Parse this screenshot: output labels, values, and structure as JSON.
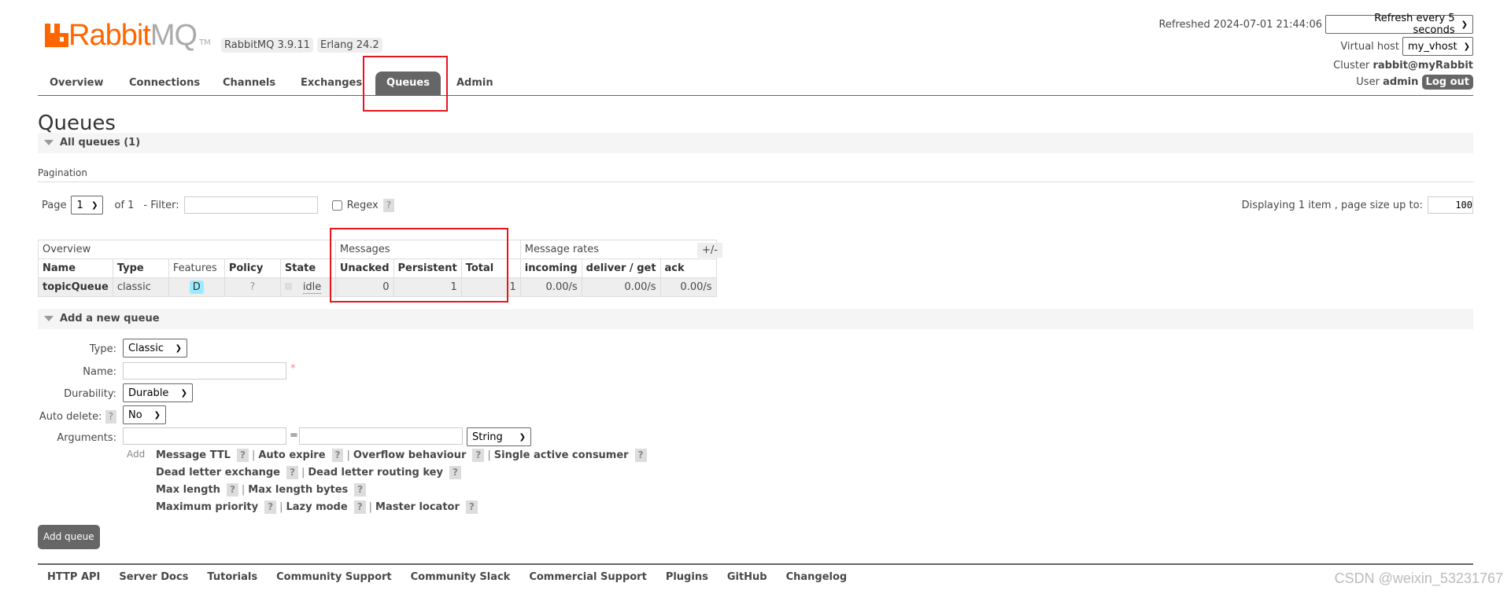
{
  "header": {
    "logo_text": "RabbitMQ",
    "logo_tm": "TM",
    "version": "RabbitMQ 3.9.11",
    "erlang": "Erlang 24.2",
    "refreshed_label": "Refreshed 2024-07-01 21:44:06",
    "refresh_select": "Refresh every 5 seconds",
    "vhost_label": "Virtual host",
    "vhost_select": "my_vhost",
    "cluster_label": "Cluster",
    "cluster_name": "rabbit@myRabbit",
    "user_label": "User",
    "user_name": "admin",
    "logout": "Log out"
  },
  "nav": {
    "tabs": [
      {
        "label": "Overview"
      },
      {
        "label": "Connections"
      },
      {
        "label": "Channels"
      },
      {
        "label": "Exchanges"
      },
      {
        "label": "Queues",
        "active": true
      },
      {
        "label": "Admin"
      }
    ]
  },
  "page": {
    "title": "Queues",
    "all_queues": "All queues (1)",
    "pagination": "Pagination",
    "page_label": "Page",
    "page_value": "1",
    "of_label": "of 1",
    "filter_label": "- Filter:",
    "filter_value": "",
    "regex_label": "Regex",
    "help": "?",
    "displaying": "Displaying 1 item , page size up to:",
    "page_size": "100"
  },
  "table": {
    "groups": [
      "Overview",
      "Messages",
      "Message rates"
    ],
    "toggle": "+/-",
    "columns": [
      "Name",
      "Type",
      "Features",
      "Policy",
      "State",
      "Unacked",
      "Persistent",
      "Total",
      "incoming",
      "deliver / get",
      "ack"
    ],
    "rows": [
      {
        "name": "topicQueue",
        "type": "classic",
        "features": "D",
        "policy": "?",
        "state": "idle",
        "unacked": "0",
        "persistent": "1",
        "total": "1",
        "incoming": "0.00/s",
        "deliver_get": "0.00/s",
        "ack": "0.00/s"
      }
    ]
  },
  "add_queue": {
    "section": "Add a new queue",
    "type_label": "Type:",
    "type_value": "Classic",
    "name_label": "Name:",
    "name_value": "",
    "required": "*",
    "durability_label": "Durability:",
    "durability_value": "Durable",
    "autodelete_label": "Auto delete:",
    "autodelete_value": "No",
    "arguments_label": "Arguments:",
    "eq": "=",
    "arg_type": "String",
    "add_label": "Add",
    "arg_lines": [
      [
        "Message TTL",
        "Auto expire",
        "Overflow behaviour",
        "Single active consumer"
      ],
      [
        "Dead letter exchange",
        "Dead letter routing key"
      ],
      [
        "Max length",
        "Max length bytes"
      ],
      [
        "Maximum priority",
        "Lazy mode",
        "Master locator"
      ]
    ],
    "submit": "Add queue"
  },
  "footer": {
    "links": [
      "HTTP API",
      "Server Docs",
      "Tutorials",
      "Community Support",
      "Community Slack",
      "Commercial Support",
      "Plugins",
      "GitHub",
      "Changelog"
    ]
  },
  "watermark": "CSDN @weixin_53231767",
  "colors": {
    "brand": "#ff6600",
    "active_tab": "#666666",
    "highlight_box": "#e8141d",
    "feature_badge": "#99ebff"
  }
}
